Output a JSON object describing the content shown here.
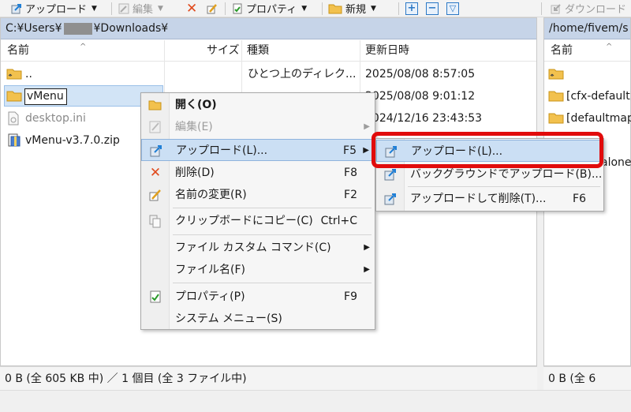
{
  "toolbar": {
    "upload": "アップロード",
    "edit": "編集",
    "properties": "プロパティ",
    "new": "新規",
    "download": "ダウンロード"
  },
  "left_pane": {
    "path_prefix": "C:¥Users¥",
    "path_suffix": "¥Downloads¥",
    "columns": {
      "name": "名前",
      "size": "サイズ",
      "type": "種類",
      "modified": "更新日時"
    },
    "files": [
      {
        "name": "..",
        "type": "ひとつ上のディレク...",
        "modified": "2025/08/08  8:57:05"
      },
      {
        "name": "vMenu",
        "type": "",
        "modified": "2025/08/08  9:01:12"
      },
      {
        "name": "desktop.ini",
        "type": "",
        "modified": "2024/12/16  23:43:53"
      },
      {
        "name": "vMenu-v3.7.0.zip",
        "type": "",
        "modified": ""
      }
    ],
    "status": "0 B  (全 605 KB 中) ／ 1 個目  (全 3 ファイル中)"
  },
  "right_pane": {
    "path": "/home/fivem/s",
    "columns": {
      "name": "名前"
    },
    "files": [
      {
        "name": ""
      },
      {
        "name": "[cfx-default]"
      },
      {
        "name": "[defaultmap"
      },
      {
        "name": "alone"
      }
    ],
    "status": "0 B  (全 6"
  },
  "context_menu": {
    "items": [
      {
        "label": "開く(O)",
        "shortcut": ""
      },
      {
        "label": "編集(E)",
        "shortcut": ""
      },
      {
        "label": "アップロード(L)...",
        "shortcut": "F5"
      },
      {
        "label": "削除(D)",
        "shortcut": "F8"
      },
      {
        "label": "名前の変更(R)",
        "shortcut": "F2"
      },
      {
        "label": "クリップボードにコピー(C)",
        "shortcut": "Ctrl+C"
      },
      {
        "label": "ファイル カスタム コマンド(C)",
        "shortcut": ""
      },
      {
        "label": "ファイル名(F)",
        "shortcut": ""
      },
      {
        "label": "プロパティ(P)",
        "shortcut": "F9"
      },
      {
        "label": "システム メニュー(S)",
        "shortcut": ""
      }
    ]
  },
  "submenu": {
    "items": [
      {
        "label": "アップロード(L)...",
        "shortcut": ""
      },
      {
        "label": "バックグラウンドでアップロード(B)...",
        "shortcut": ""
      },
      {
        "label": "アップロードして削除(T)...",
        "shortcut": "F6"
      }
    ]
  },
  "colors": {
    "path_bar": "#c6d4e8",
    "selection": "#d2e4f6",
    "menu_highlight": "#cbdff4",
    "annotation": "#e10b0b",
    "folder": "#f2c14e"
  }
}
